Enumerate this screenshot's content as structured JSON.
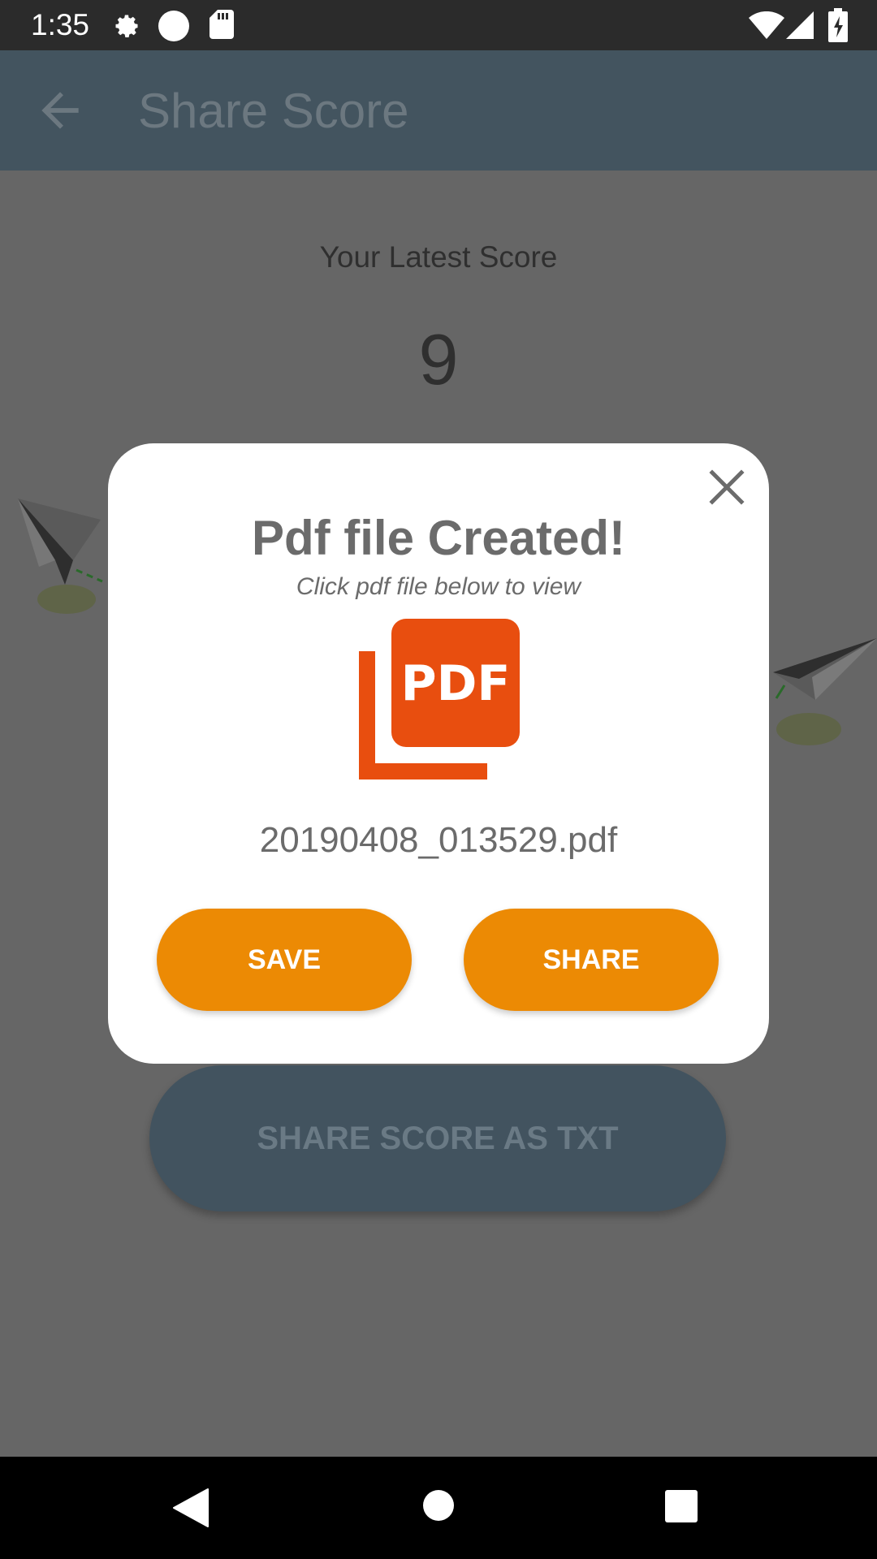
{
  "status_bar": {
    "time": "1:35",
    "icons": [
      "gear-icon",
      "circle-icon",
      "sd-card-icon",
      "wifi-icon",
      "signal-icon",
      "battery-charging-icon"
    ]
  },
  "app_bar": {
    "title": "Share Score",
    "back_icon": "arrow-left-icon"
  },
  "content": {
    "latest_label": "Your Latest Score",
    "score": "9",
    "share_txt_label": "SHARE SCORE AS TXT"
  },
  "dialog": {
    "title": "Pdf file Created!",
    "subtitle": "Click pdf file below to view",
    "pdf_icon_text": "PDF",
    "file_name": "20190408_013529.pdf",
    "save_label": "SAVE",
    "share_label": "SHARE",
    "close_icon": "close-icon"
  },
  "nav_bar": {
    "icons": [
      "back-triangle-icon",
      "home-circle-icon",
      "recents-square-icon"
    ]
  },
  "colors": {
    "accent": "#ec8a04",
    "app_bar": "#43545f",
    "pdf_red": "#e84e0f"
  }
}
